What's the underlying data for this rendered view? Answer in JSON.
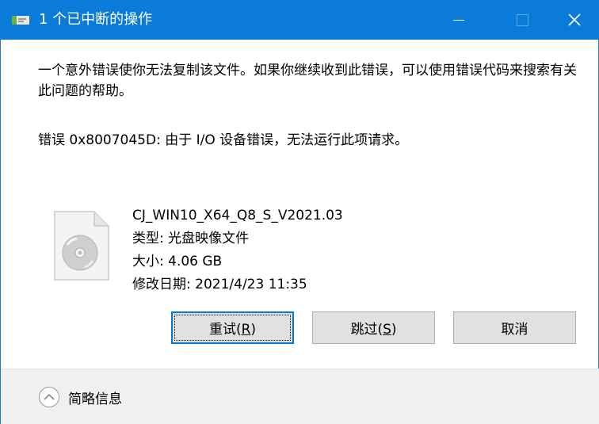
{
  "window": {
    "title": "1 个已中断的操作",
    "close_glyph": "✕"
  },
  "message": {
    "body": "一个意外错误使你无法复制该文件。如果你继续收到此错误，可以使用错误代码来搜索有关此问题的帮助。",
    "error": "错误 0x8007045D: 由于 I/O 设备错误，无法运行此项请求。"
  },
  "file": {
    "name": "CJ_WIN10_X64_Q8_S_V2021.03",
    "type": "类型: 光盘映像文件",
    "size": "大小: 4.06 GB",
    "modified": "修改日期: 2021/4/23 11:35",
    "icon": "disc-image-file-icon"
  },
  "buttons": {
    "retry_label": "重试",
    "retry_key": "R",
    "skip_label": "跳过",
    "skip_key": "S",
    "cancel_label": "取消"
  },
  "footer": {
    "details_label": "简略信息"
  },
  "colors": {
    "titlebar": "#0b7bd9",
    "button_bg": "#e1e1e1",
    "footer_bg": "#f0f0f0"
  }
}
